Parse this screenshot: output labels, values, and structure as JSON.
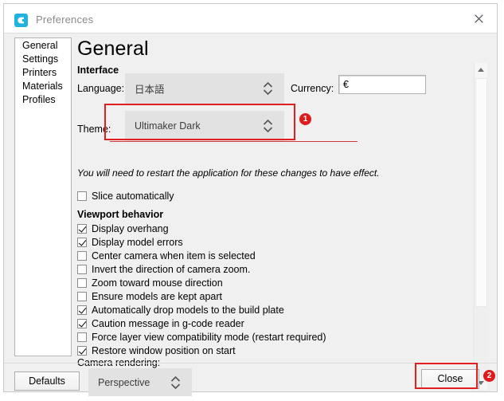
{
  "window": {
    "title": "Preferences",
    "app_icon": "cura-logo-icon",
    "close_icon": "close-icon"
  },
  "sidebar": {
    "items": [
      {
        "label": "General"
      },
      {
        "label": "Settings"
      },
      {
        "label": "Printers"
      },
      {
        "label": "Materials"
      },
      {
        "label": "Profiles"
      }
    ]
  },
  "content": {
    "page_title": "General",
    "interface": {
      "heading": "Interface",
      "language_label": "Language:",
      "language_value": "日本語",
      "currency_label": "Currency:",
      "currency_value": "€",
      "theme_label": "Theme:",
      "theme_value": "Ultimaker Dark",
      "restart_note": "You will need to restart the application for these changes to have effect."
    },
    "slice_automatically": {
      "label": "Slice automatically",
      "checked": false
    },
    "viewport": {
      "heading": "Viewport behavior",
      "options": [
        {
          "label": "Display overhang",
          "checked": true
        },
        {
          "label": "Display model errors",
          "checked": true
        },
        {
          "label": "Center camera when item is selected",
          "checked": false
        },
        {
          "label": "Invert the direction of camera zoom.",
          "checked": false
        },
        {
          "label": "Zoom toward mouse direction",
          "checked": false
        },
        {
          "label": "Ensure models are kept apart",
          "checked": false
        },
        {
          "label": "Automatically drop models to the build plate",
          "checked": true
        },
        {
          "label": "Caution message in g-code reader",
          "checked": true
        },
        {
          "label": "Force layer view compatibility mode (restart required)",
          "checked": false
        },
        {
          "label": "Restore window position on start",
          "checked": true
        }
      ],
      "camera_rendering_label": "Camera rendering:",
      "camera_rendering_value": "Perspective"
    }
  },
  "footer": {
    "defaults_label": "Defaults",
    "close_label": "Close"
  },
  "annotations": {
    "badge_1": "1",
    "badge_2": "2",
    "color": "#e01b1b"
  },
  "scrollbar": {
    "up_icon": "scroll-up-arrow-icon",
    "down_icon": "scroll-down-arrow-icon"
  }
}
